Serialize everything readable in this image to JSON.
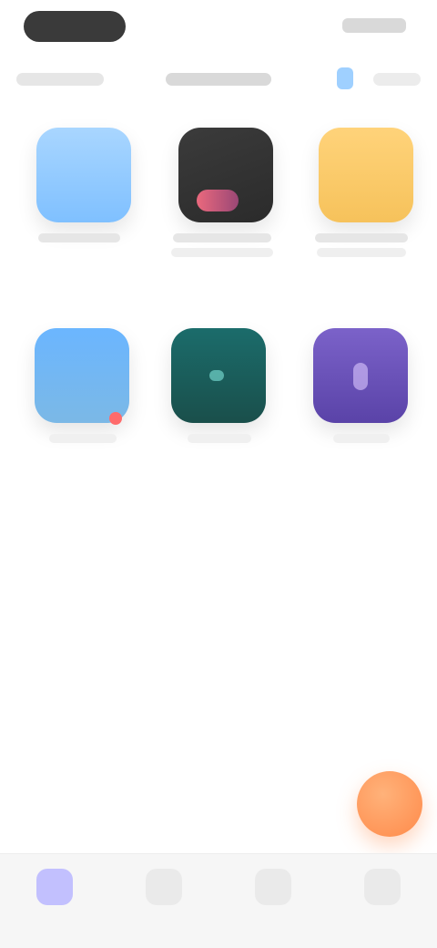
{
  "colors": {
    "background": "#ffffff",
    "status_pill": "#3a3a3a",
    "accent_blue": "#9fd0ff",
    "fab": "#ff8a4a",
    "nav_active": "#b8b6ff"
  },
  "app_tiles": [
    {
      "icon": "app-tile-1",
      "color": "#7fc0ff"
    },
    {
      "icon": "app-tile-2",
      "color": "#2b2b2b"
    },
    {
      "icon": "app-tile-3",
      "color": "#f6c25b"
    },
    {
      "icon": "app-tile-4",
      "color": "#6bb6ff"
    },
    {
      "icon": "app-tile-5",
      "color": "#1a4f4b"
    },
    {
      "icon": "app-tile-6",
      "color": "#5a43a8"
    }
  ],
  "bottom_nav": {
    "items": [
      {
        "icon": "nav-item-1-icon"
      },
      {
        "icon": "nav-item-2-icon"
      },
      {
        "icon": "nav-item-3-icon"
      },
      {
        "icon": "nav-item-4-icon"
      }
    ]
  }
}
